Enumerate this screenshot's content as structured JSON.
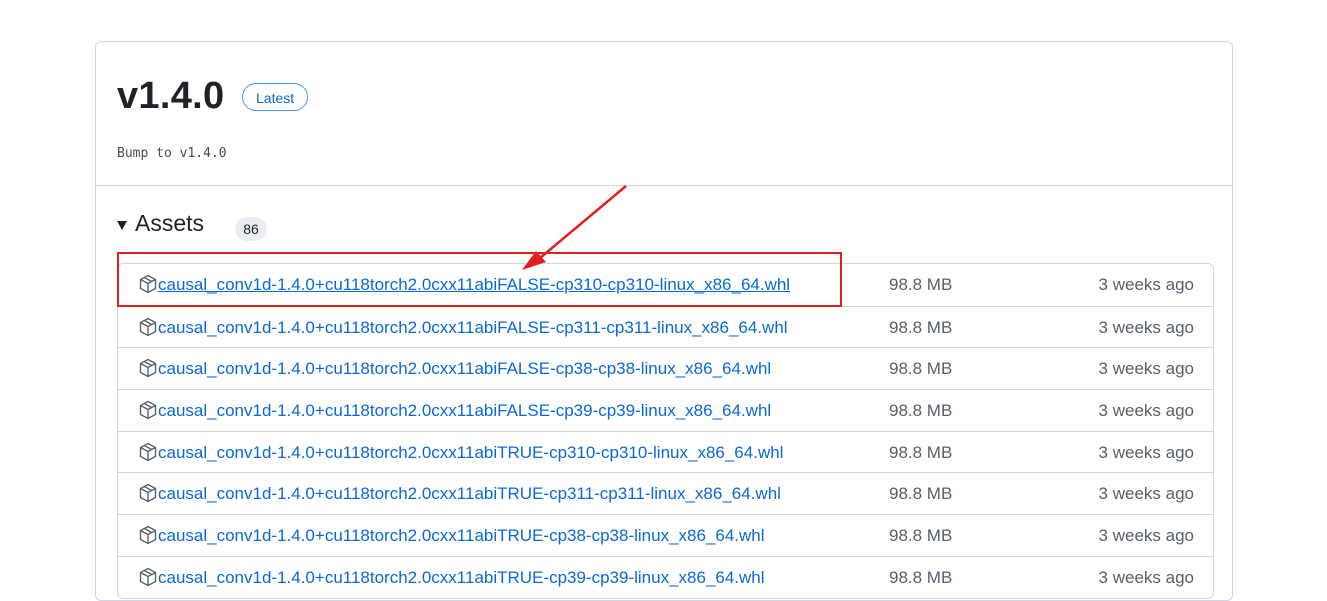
{
  "release": {
    "title": "v1.4.0",
    "badge": "Latest",
    "body": "Bump to v1.4.0"
  },
  "assets": {
    "label": "Assets",
    "count": "86",
    "items": [
      {
        "name": "causal_conv1d-1.4.0+cu118torch2.0cxx11abiFALSE-cp310-cp310-linux_x86_64.whl",
        "size": "98.8 MB",
        "date": "3 weeks ago"
      },
      {
        "name": "causal_conv1d-1.4.0+cu118torch2.0cxx11abiFALSE-cp311-cp311-linux_x86_64.whl",
        "size": "98.8 MB",
        "date": "3 weeks ago"
      },
      {
        "name": "causal_conv1d-1.4.0+cu118torch2.0cxx11abiFALSE-cp38-cp38-linux_x86_64.whl",
        "size": "98.8 MB",
        "date": "3 weeks ago"
      },
      {
        "name": "causal_conv1d-1.4.0+cu118torch2.0cxx11abiFALSE-cp39-cp39-linux_x86_64.whl",
        "size": "98.8 MB",
        "date": "3 weeks ago"
      },
      {
        "name": "causal_conv1d-1.4.0+cu118torch2.0cxx11abiTRUE-cp310-cp310-linux_x86_64.whl",
        "size": "98.8 MB",
        "date": "3 weeks ago"
      },
      {
        "name": "causal_conv1d-1.4.0+cu118torch2.0cxx11abiTRUE-cp311-cp311-linux_x86_64.whl",
        "size": "98.8 MB",
        "date": "3 weeks ago"
      },
      {
        "name": "causal_conv1d-1.4.0+cu118torch2.0cxx11abiTRUE-cp38-cp38-linux_x86_64.whl",
        "size": "98.8 MB",
        "date": "3 weeks ago"
      },
      {
        "name": "causal_conv1d-1.4.0+cu118torch2.0cxx11abiTRUE-cp39-cp39-linux_x86_64.whl",
        "size": "98.8 MB",
        "date": "3 weeks ago"
      }
    ]
  },
  "colors": {
    "link": "#0969da",
    "muted": "#57606a",
    "annotation": "#e02020"
  }
}
